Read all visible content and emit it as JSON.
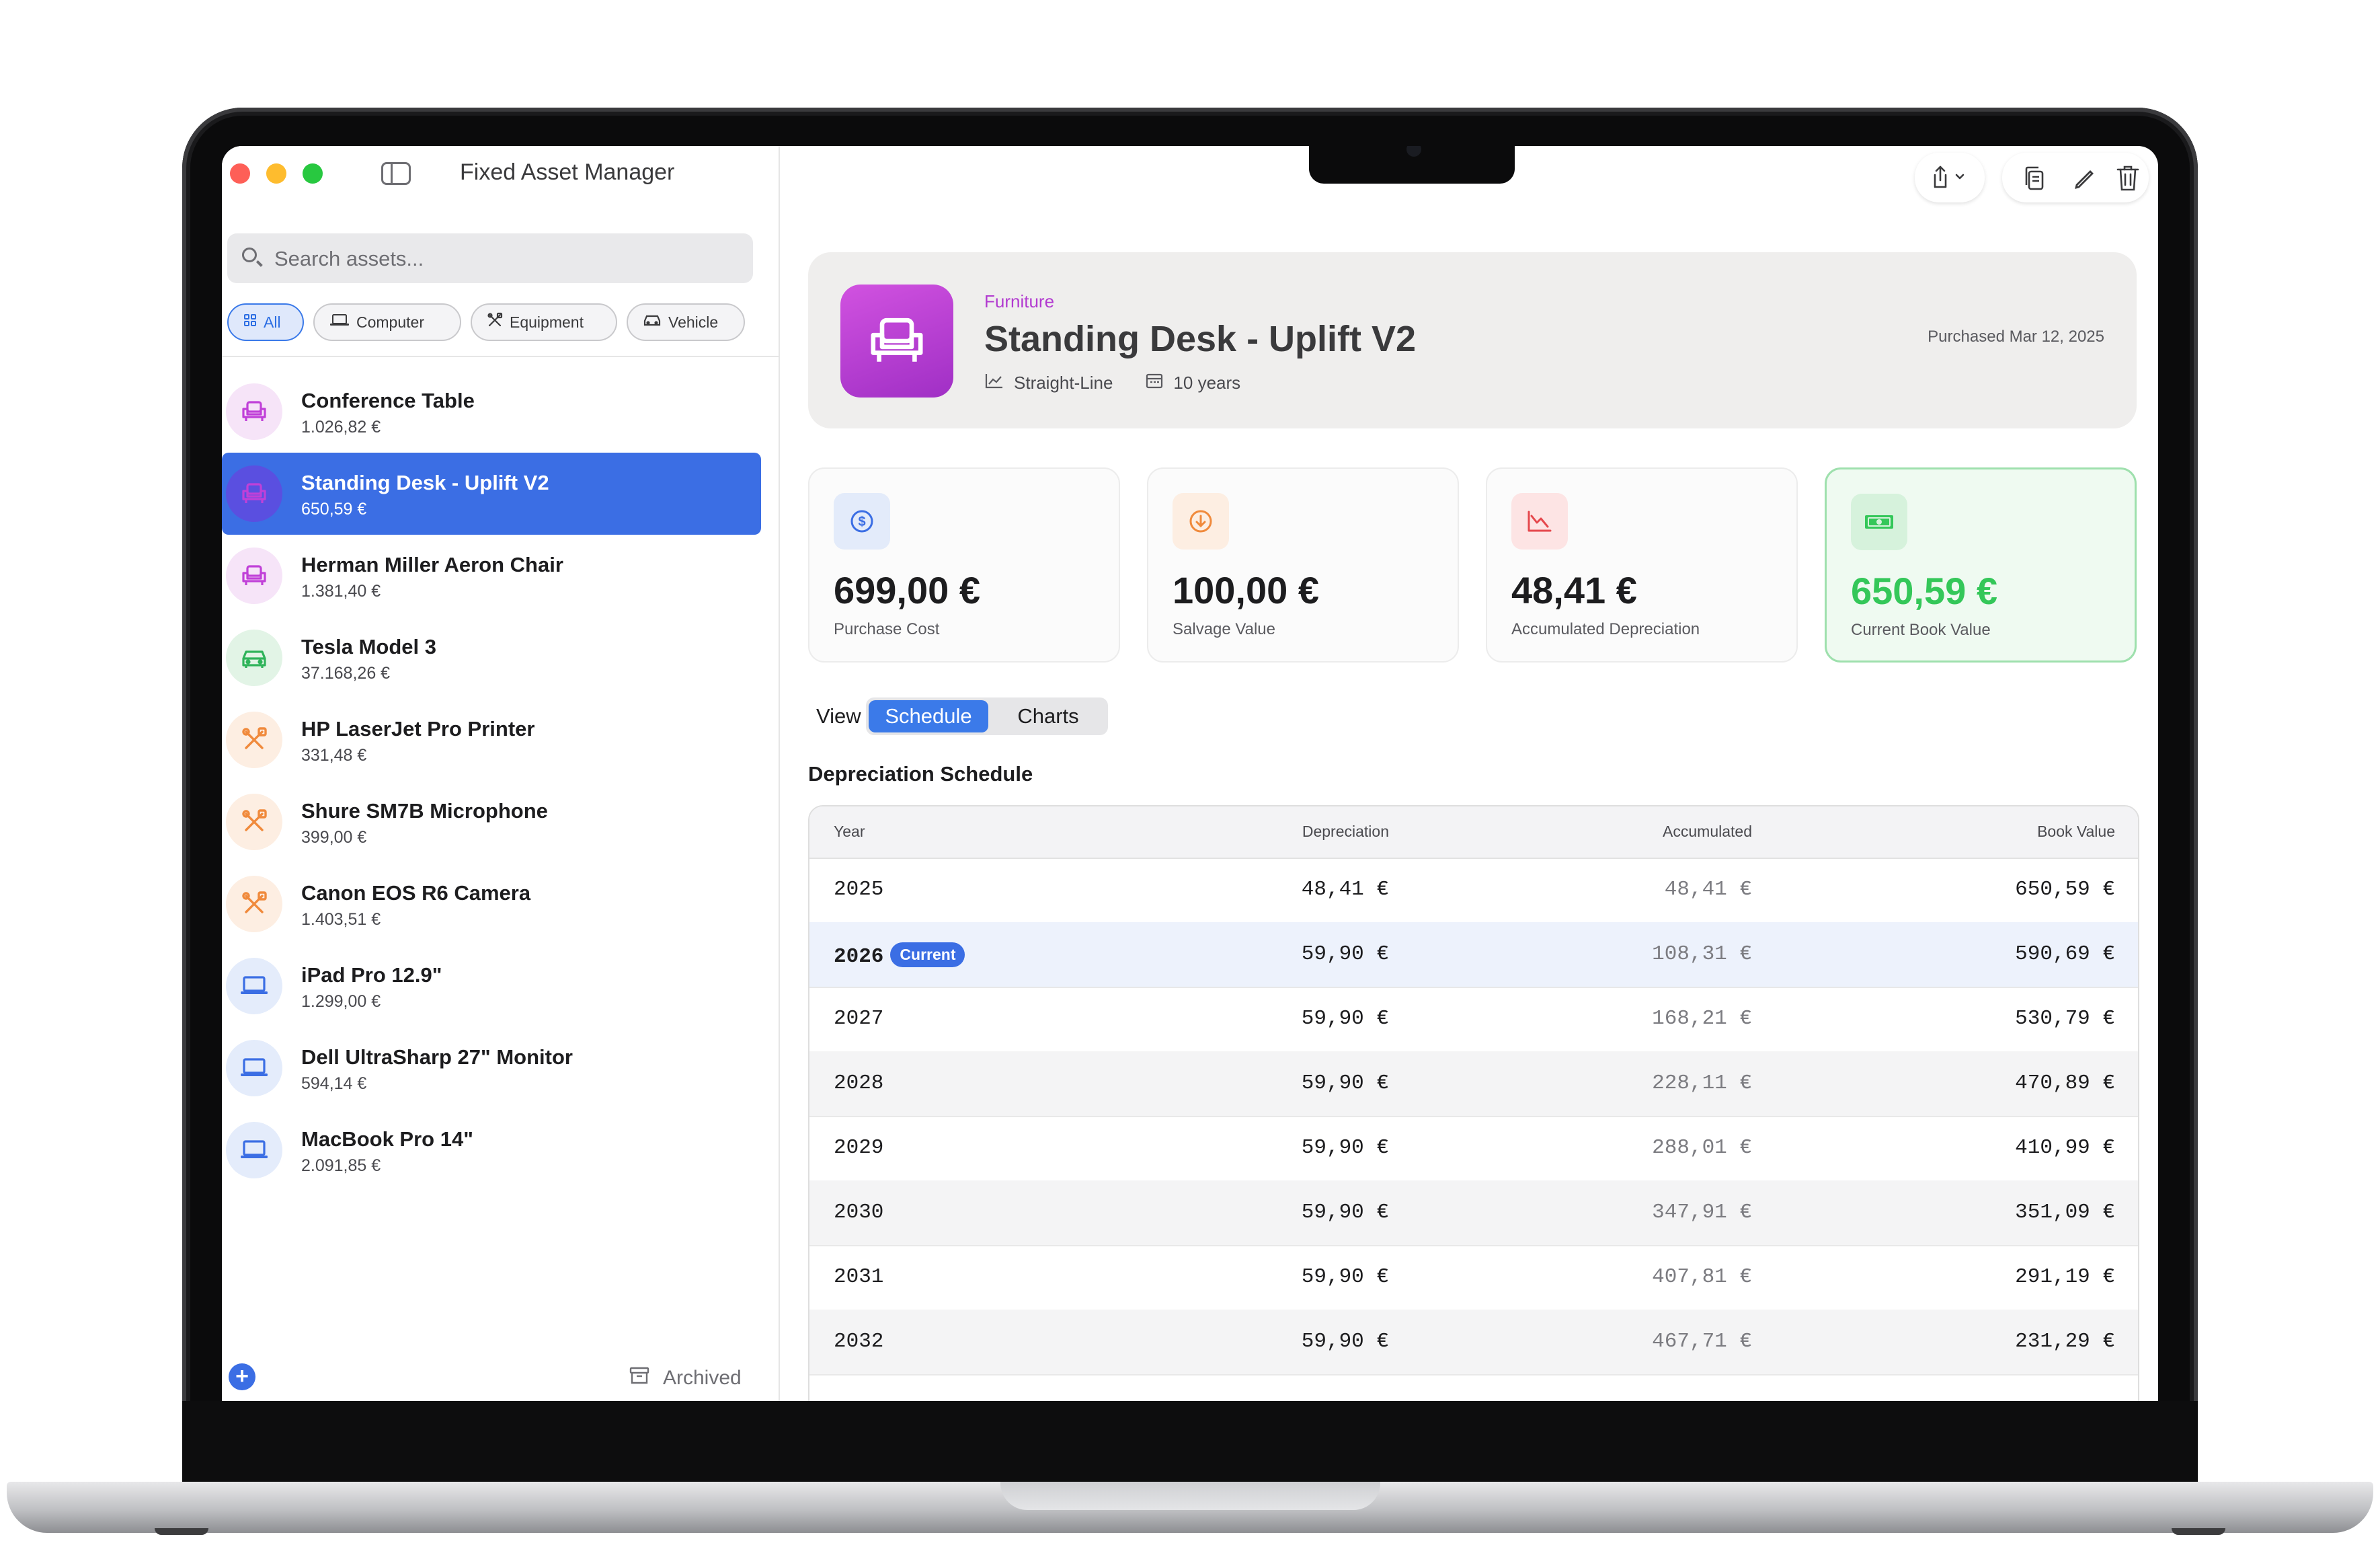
{
  "app": {
    "title": "Fixed Asset Manager"
  },
  "search": {
    "placeholder": "Search assets..."
  },
  "filters": [
    {
      "label": "All",
      "icon": "grid-icon"
    },
    {
      "label": "Computer",
      "icon": "laptop-icon"
    },
    {
      "label": "Equipment",
      "icon": "tools-icon"
    },
    {
      "label": "Vehicle",
      "icon": "car-icon"
    }
  ],
  "assets": [
    {
      "name": "Conference Table",
      "value": "1.026,82 €",
      "category": "furniture"
    },
    {
      "name": "Standing Desk - Uplift V2",
      "value": "650,59 €",
      "category": "furniture"
    },
    {
      "name": "Herman Miller Aeron Chair",
      "value": "1.381,40 €",
      "category": "furniture"
    },
    {
      "name": "Tesla Model 3",
      "value": "37.168,26 €",
      "category": "vehicle"
    },
    {
      "name": "HP LaserJet Pro Printer",
      "value": "331,48 €",
      "category": "equipment"
    },
    {
      "name": "Shure SM7B Microphone",
      "value": "399,00 €",
      "category": "equipment"
    },
    {
      "name": "Canon EOS R6 Camera",
      "value": "1.403,51 €",
      "category": "equipment"
    },
    {
      "name": "iPad Pro 12.9\"",
      "value": "1.299,00 €",
      "category": "computer"
    },
    {
      "name": "Dell UltraSharp 27\" Monitor",
      "value": "594,14 €",
      "category": "computer"
    },
    {
      "name": "MacBook Pro 14\"",
      "value": "2.091,85 €",
      "category": "computer"
    }
  ],
  "sidebar_footer": {
    "archived_label": "Archived"
  },
  "detail": {
    "category": "Furniture",
    "title": "Standing Desk - Uplift V2",
    "method": "Straight-Line",
    "life": "10 years",
    "purchased": "Purchased Mar 12, 2025"
  },
  "stats": [
    {
      "value": "699,00 €",
      "label": "Purchase Cost",
      "icon": "dollar-icon"
    },
    {
      "value": "100,00 €",
      "label": "Salvage Value",
      "icon": "arrow-down-circle-icon"
    },
    {
      "value": "48,41 €",
      "label": "Accumulated Depreciation",
      "icon": "chart-down-icon"
    },
    {
      "value": "650,59 €",
      "label": "Current Book Value",
      "icon": "banknote-icon"
    }
  ],
  "view": {
    "label": "View",
    "tabs": [
      "Schedule",
      "Charts"
    ],
    "selected": "Schedule"
  },
  "schedule": {
    "title": "Depreciation Schedule",
    "columns": [
      "Year",
      "Depreciation",
      "Accumulated",
      "Book Value"
    ],
    "current_badge": "Current",
    "rows": [
      {
        "year": "2025",
        "dep": "48,41 €",
        "acc": "48,41 €",
        "book": "650,59 €"
      },
      {
        "year": "2026",
        "dep": "59,90 €",
        "acc": "108,31 €",
        "book": "590,69 €"
      },
      {
        "year": "2027",
        "dep": "59,90 €",
        "acc": "168,21 €",
        "book": "530,79 €"
      },
      {
        "year": "2028",
        "dep": "59,90 €",
        "acc": "228,11 €",
        "book": "470,89 €"
      },
      {
        "year": "2029",
        "dep": "59,90 €",
        "acc": "288,01 €",
        "book": "410,99 €"
      },
      {
        "year": "2030",
        "dep": "59,90 €",
        "acc": "347,91 €",
        "book": "351,09 €"
      },
      {
        "year": "2031",
        "dep": "59,90 €",
        "acc": "407,81 €",
        "book": "291,19 €"
      },
      {
        "year": "2032",
        "dep": "59,90 €",
        "acc": "467,71 €",
        "book": "231,29 €"
      }
    ]
  },
  "colors": {
    "accent": "#3b6ee4",
    "furniture": "#c040d8",
    "vehicle": "#2fb35a",
    "equipment": "#f08a3c",
    "computer": "#3b6ee4",
    "book_value": "#34c759"
  }
}
